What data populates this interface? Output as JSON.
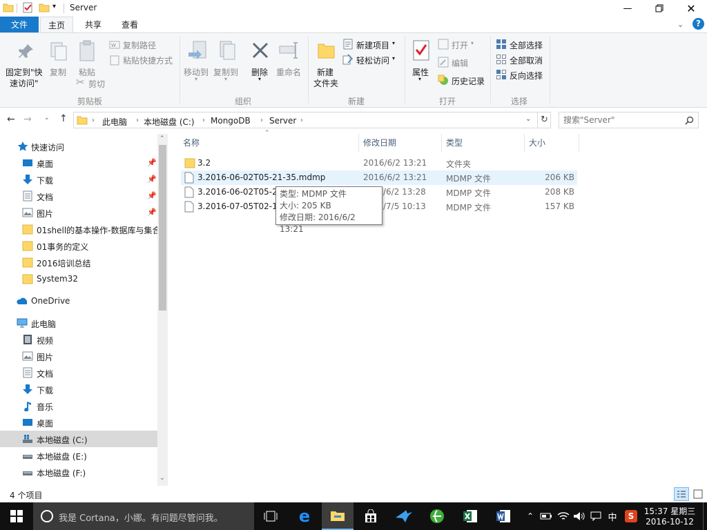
{
  "window": {
    "title": "Server"
  },
  "ribbon_tabs": [
    "文件",
    "主页",
    "共享",
    "查看"
  ],
  "ribbon": {
    "clipboard": {
      "pin_label_1": "固定到\"快",
      "pin_label_2": "速访问\"",
      "copy": "复制",
      "paste": "粘贴",
      "copy_path": "复制路径",
      "paste_shortcut": "粘贴快捷方式",
      "cut": "剪切",
      "group": "剪贴板"
    },
    "organize": {
      "move_to": "移动到",
      "copy_to": "复制到",
      "delete": "删除",
      "rename": "重命名",
      "group": "组织"
    },
    "new": {
      "new_folder_1": "新建",
      "new_folder_2": "文件夹",
      "new_item": "新建项目",
      "easy_access": "轻松访问",
      "group": "新建"
    },
    "open": {
      "properties": "属性",
      "open": "打开",
      "edit": "编辑",
      "history": "历史记录",
      "group": "打开"
    },
    "select": {
      "select_all": "全部选择",
      "select_none": "全部取消",
      "invert": "反向选择",
      "group": "选择"
    }
  },
  "address": {
    "crumbs": [
      "此电脑",
      "本地磁盘 (C:)",
      "MongoDB",
      "Server"
    ],
    "search_placeholder": "搜索\"Server\""
  },
  "nav": {
    "quick_access": "快速访问",
    "quick_items": [
      "桌面",
      "下载",
      "文档",
      "图片",
      "01shell的基本操作-数据库与集合",
      "01事务的定义",
      "2016培训总结",
      "System32"
    ],
    "onedrive": "OneDrive",
    "this_pc": "此电脑",
    "pc_items": [
      "视频",
      "图片",
      "文档",
      "下载",
      "音乐",
      "桌面",
      "本地磁盘 (C:)",
      "本地磁盘 (E:)",
      "本地磁盘 (F:)"
    ]
  },
  "columns": {
    "name": "名称",
    "date": "修改日期",
    "type": "类型",
    "size": "大小"
  },
  "files": [
    {
      "name": "3.2",
      "date": "2016/6/2 13:21",
      "type": "文件夹",
      "size": ""
    },
    {
      "name": "3.2016-06-02T05-21-35.mdmp",
      "date": "2016/6/2 13:21",
      "type": "MDMP 文件",
      "size": "206 KB"
    },
    {
      "name": "3.2016-06-02T05-28",
      "date": "/6/2 13:28",
      "type": "MDMP 文件",
      "size": "208 KB"
    },
    {
      "name": "3.2016-07-05T02-13",
      "date": "/7/5 10:13",
      "type": "MDMP 文件",
      "size": "157 KB"
    }
  ],
  "tooltip": {
    "type": "类型: MDMP 文件",
    "size": "大小: 205 KB",
    "date": "修改日期: 2016/6/2 13:21"
  },
  "status": {
    "count": "4 个项目"
  },
  "taskbar": {
    "cortana": "我是 Cortana，小娜。有问题尽管问我。",
    "ime": "中",
    "time": "15:37 星期三",
    "date": "2016-10-12"
  },
  "colors": {
    "accent": "#1979ca",
    "selected": "#cce8ff",
    "hover": "#e5f3ff",
    "taskbar": "#101010"
  }
}
